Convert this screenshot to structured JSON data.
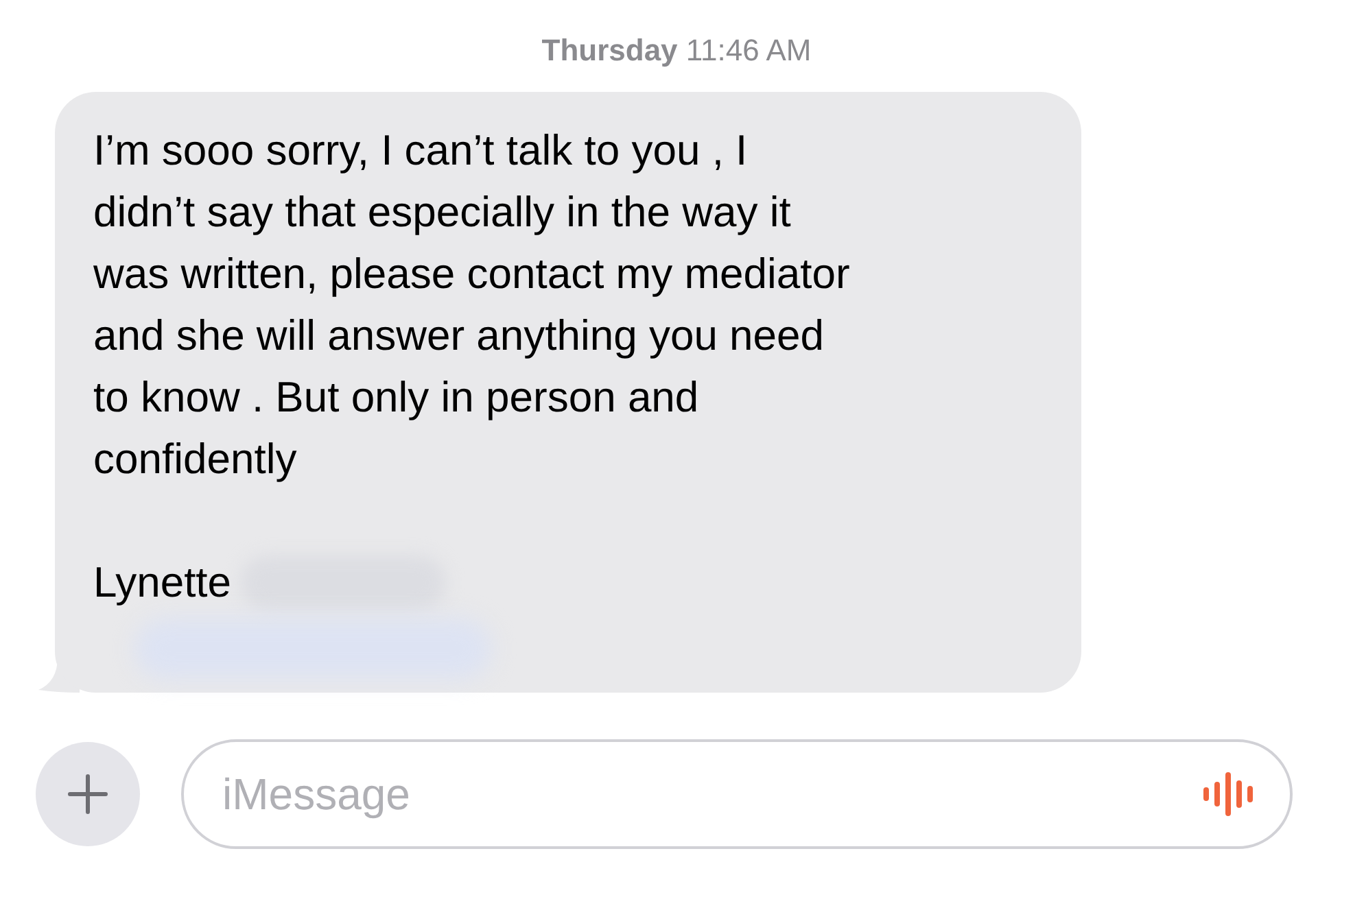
{
  "timestamp": {
    "day": "Thursday",
    "time": "11:46 AM"
  },
  "message": {
    "text": "I’m sooo sorry, I can’t talk to you , I\ndidn’t say that especially in the way it\nwas written, please contact my mediator\nand she will answer anything you need\nto know . But only in person and\nconfidently",
    "signature": "Lynette"
  },
  "composer": {
    "placeholder": "iMessage"
  }
}
